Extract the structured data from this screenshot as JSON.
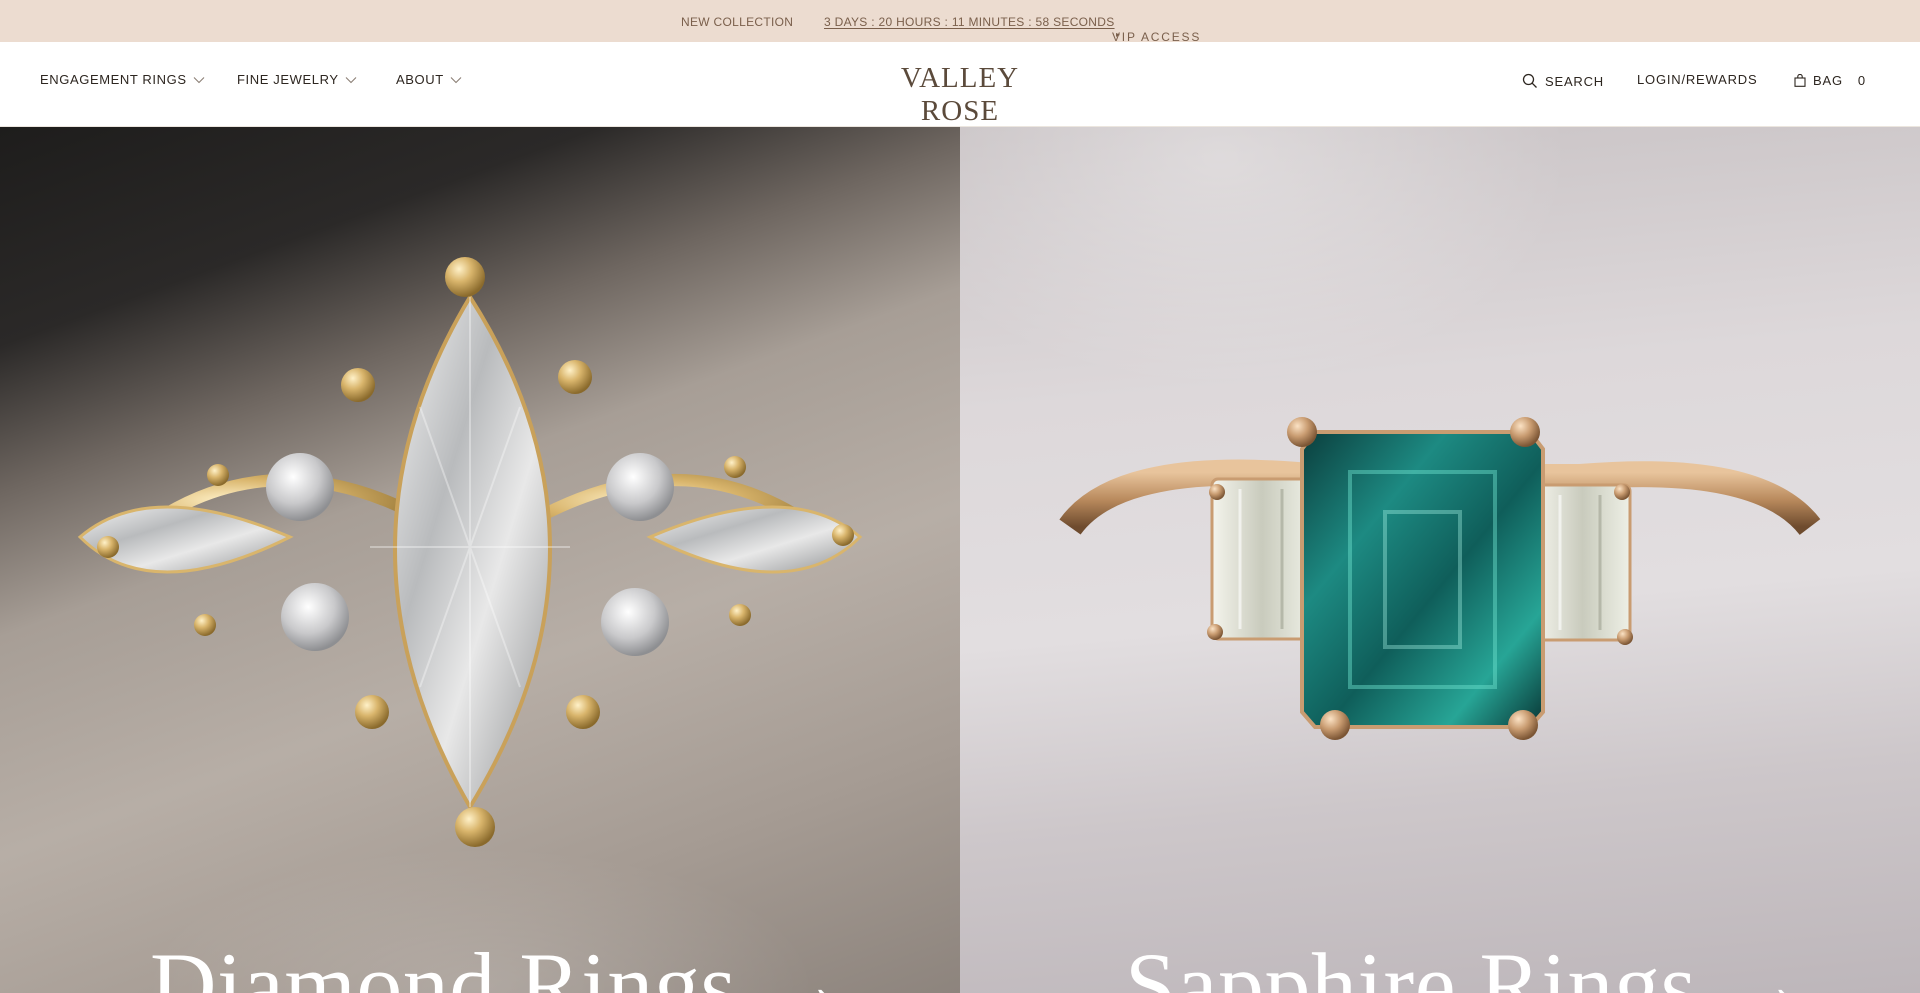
{
  "announcement": {
    "collection": "NEW COLLECTION",
    "countdown": "3 DAYS : 20 HOURS : 11 MINUTES : 58 SECONDS",
    "vip": "VIP ACCESS",
    "vip_caret": "▸"
  },
  "header": {
    "nav": {
      "engagement": "ENGAGEMENT RINGS",
      "fine": "FINE JEWELRY",
      "about": "ABOUT"
    },
    "logo": "VALLEY ROSE",
    "search": "SEARCH",
    "login": "LOGIN/REWARDS",
    "bag": "BAG",
    "bag_count": "0"
  },
  "hero": {
    "left": {
      "title": "Diamond Rings →",
      "image": "marquise diamond cluster ring"
    },
    "right": {
      "title": "Sapphire Rings →",
      "image": "emerald-cut teal sapphire three-stone ring"
    }
  },
  "colors": {
    "announcement_bg": "#ecdcd0",
    "announcement_text": "#7a5f4b",
    "logo": "#5b4a3b",
    "gold": "#c9a15a",
    "teal": "#0f5e5a"
  }
}
